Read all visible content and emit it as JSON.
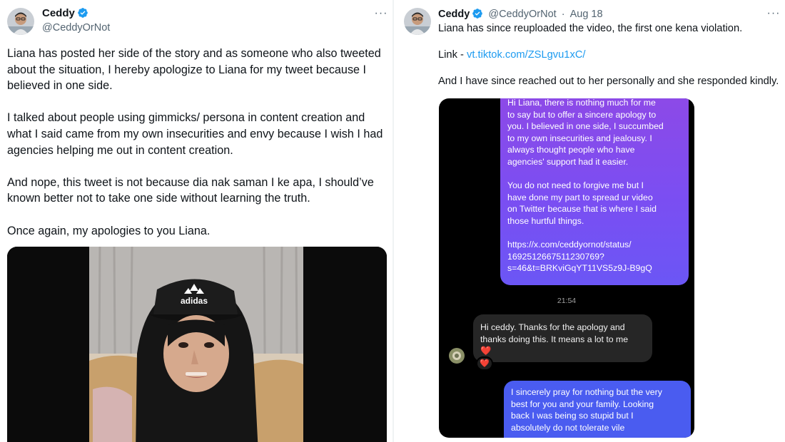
{
  "left_tweet": {
    "author": {
      "name": "Ceddy",
      "handle": "@CeddyOrNot"
    },
    "more_icon": "more-horizontal-icon",
    "paragraphs": [
      "Liana has posted her side of the story and as someone who also tweeted\nabout the situation, I hereby apologize to Liana for my tweet because I\nbelieved in one side.",
      "I talked about people using gimmicks/ persona in content creation and\nwhat I said came from my own insecurities and envy because I wish I had\nagencies helping me out in content creation.",
      "And nope, this tweet is not because dia nak saman I ke apa, I should’ve\nknown better not to take one side without learning the truth.",
      "Once again, my apologies to you Liana."
    ],
    "media": {
      "cap_logo": "adidas"
    }
  },
  "right_tweet": {
    "author": {
      "name": "Ceddy",
      "handle": "@CeddyOrNot",
      "date": "Aug 18"
    },
    "separator": "·",
    "line1": "Liana has since reuploaded the video, the first one kena violation.",
    "link_prefix": "Link - ",
    "link_text": "vt.tiktok.com/ZSLgvu1xC/",
    "line3": "And I have since reached out to her personally and she responded kindly.",
    "chat": {
      "sent_paragraphs": [
        "Hi Liana, there is nothing much for me\nto say but to offer a sincere apology to\nyou. I believed in one side, I succumbed\nto my own insecurities and jealousy. I\nalways thought people who have\nagencies' support had it easier.",
        "You do not need to forgive me but I\nhave done my part to spread ur video\non Twitter because that is where I said\nthose hurtful things.",
        "https://x.com/ceddyornot/status/\n1692512667511230769?\ns=46&t=BRKviGqYT11VS5z9J-B9gQ"
      ],
      "time": "21:54",
      "received": "Hi ceddy. Thanks for the apology and\nthanks doing this. It means a lot to me",
      "received_emoji": "❤️",
      "reaction": "❤️",
      "sent2": "I sincerely pray for nothing but the very\nbest for you and your family. Looking\nback I was being so stupid but I\nabsolutely do not tolerate vile"
    }
  },
  "colors": {
    "verified_blue": "#1d9bf0",
    "link_blue": "#1d9bf0",
    "secondary_text": "#536471",
    "chat_sent_purple": "#7b4ef2",
    "chat_sent_blue": "#4a5cf0",
    "chat_received": "#262626"
  }
}
